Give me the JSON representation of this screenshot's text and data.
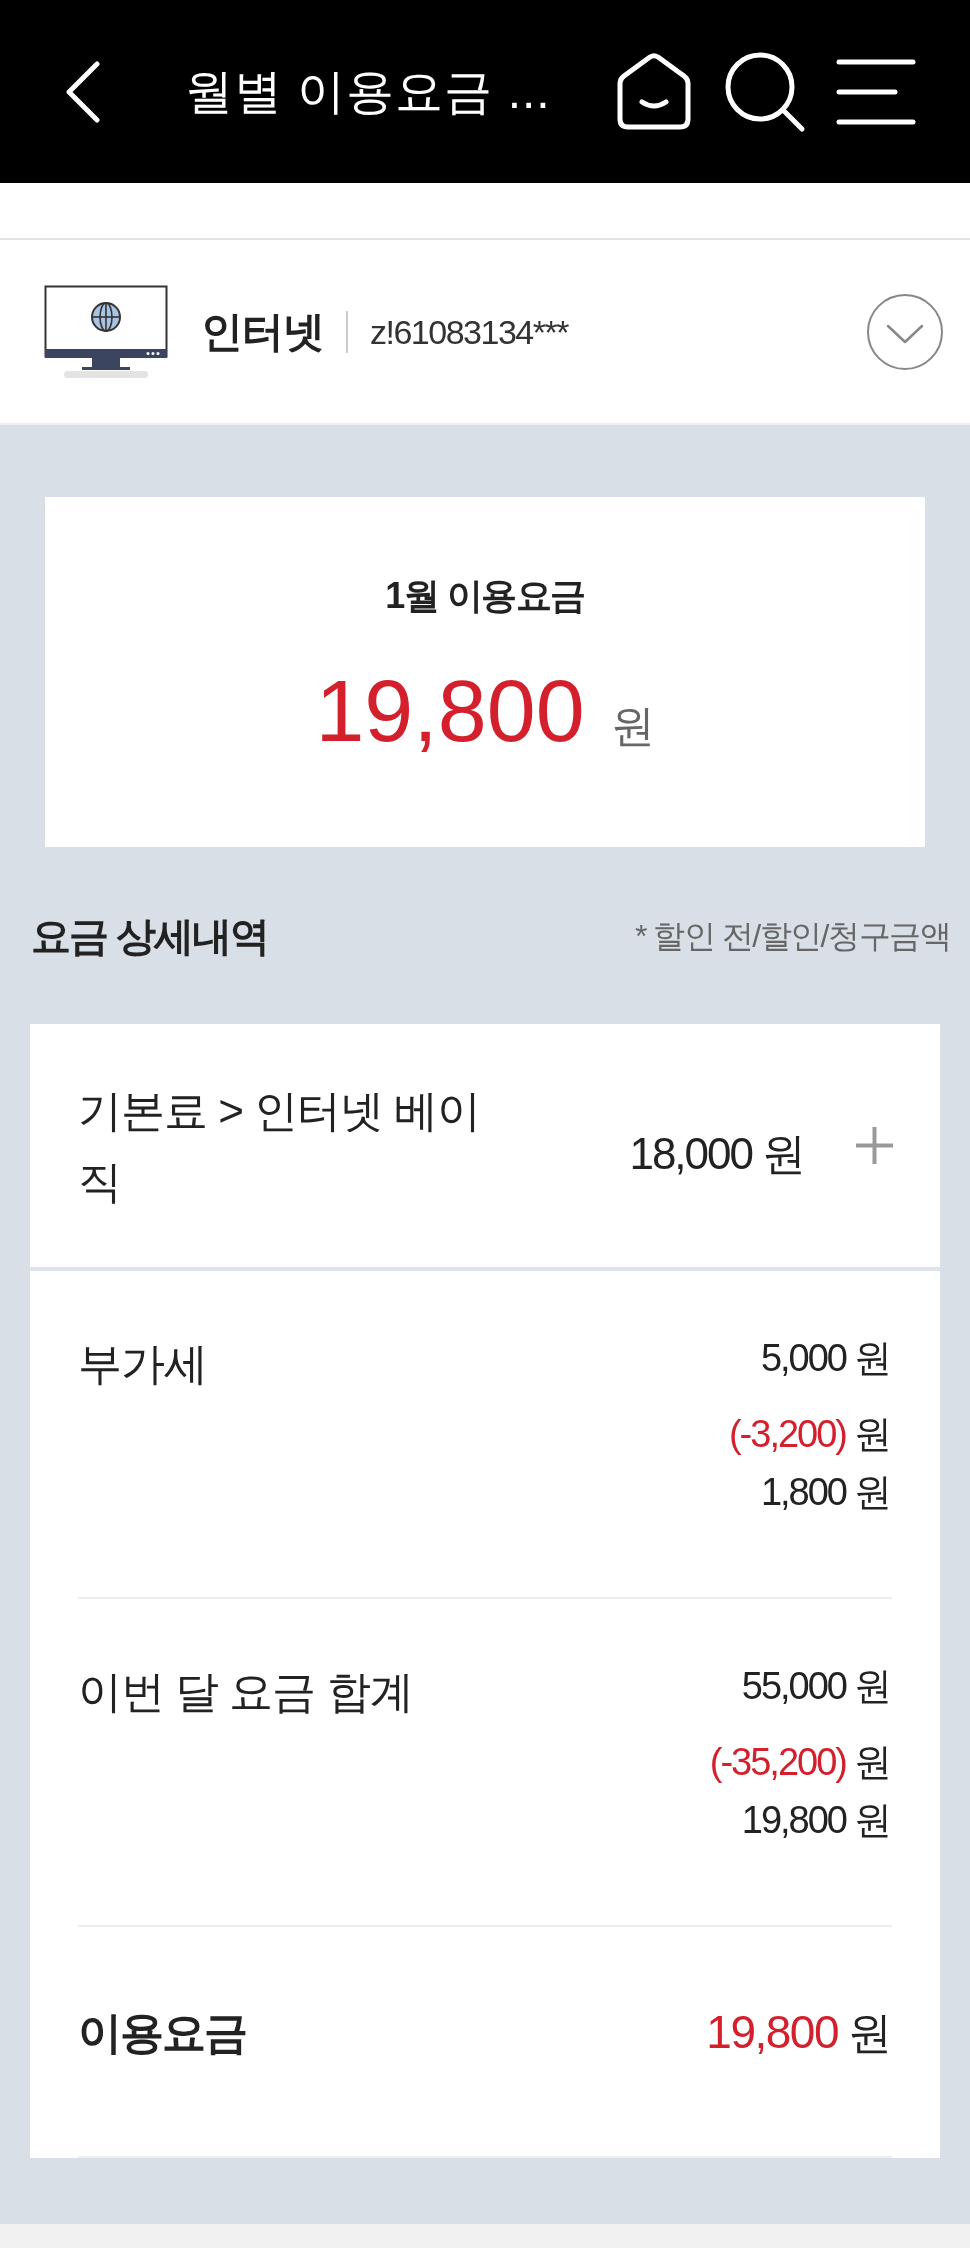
{
  "header": {
    "title": "월별 이용요금 ..."
  },
  "service": {
    "name": "인터넷",
    "account": "z!61083134***"
  },
  "summary": {
    "title": "1월 이용요금",
    "amount": "19,800",
    "unit": "원"
  },
  "details": {
    "title": "요금 상세내역",
    "legend": "* 할인 전/할인/청구금액",
    "items": [
      {
        "kind": "expandable",
        "label": "기본료 > 인터넷 베이직",
        "amount": "18,000",
        "unit": "원",
        "expanded": false
      },
      {
        "kind": "breakdown",
        "label": "부가세",
        "lines": [
          {
            "kind": "original",
            "amount": "5,000",
            "unit": "원"
          },
          {
            "kind": "discount",
            "amount": "(-3,200)",
            "unit": "원"
          },
          {
            "kind": "billed",
            "amount": "1,800",
            "unit": "원"
          }
        ]
      },
      {
        "kind": "breakdown",
        "label": "이번 달 요금 합계",
        "lines": [
          {
            "kind": "original",
            "amount": "55,000",
            "unit": "원"
          },
          {
            "kind": "discount",
            "amount": "(-35,200)",
            "unit": "원"
          },
          {
            "kind": "billed",
            "amount": "19,800",
            "unit": "원"
          }
        ]
      },
      {
        "kind": "total",
        "label": "이용요금",
        "amount": "19,800",
        "unit": "원"
      }
    ]
  }
}
